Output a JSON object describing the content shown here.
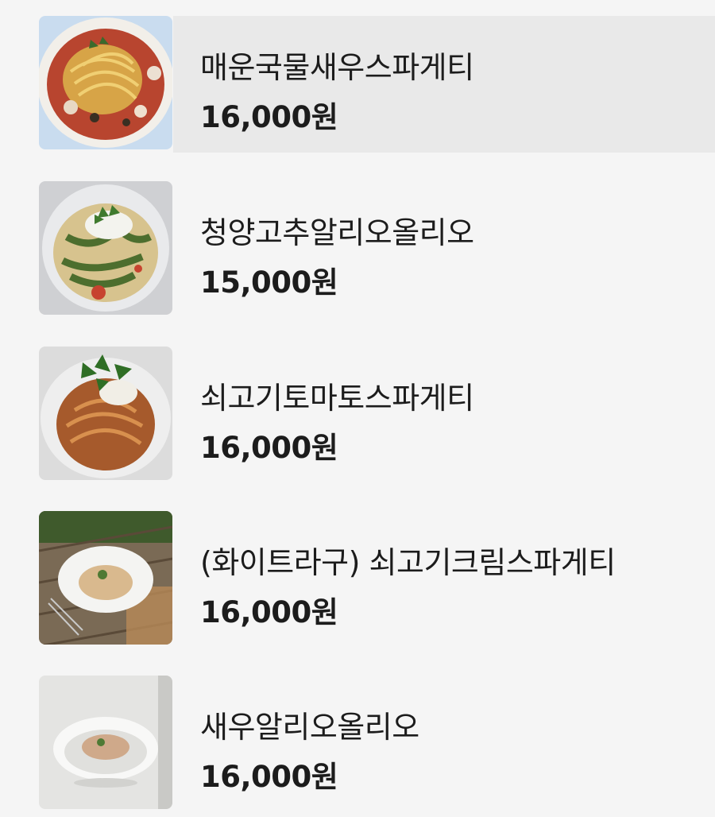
{
  "menu": {
    "items": [
      {
        "name": "매운국물새우스파게티",
        "price": "16,000원",
        "image_icon": "spicy-shrimp-spaghetti-photo"
      },
      {
        "name": "청양고추알리오올리오",
        "price": "15,000원",
        "image_icon": "chili-aglio-olio-photo"
      },
      {
        "name": "쇠고기토마토스파게티",
        "price": "16,000원",
        "image_icon": "beef-tomato-spaghetti-photo"
      },
      {
        "name": "(화이트라구) 쇠고기크림스파게티",
        "price": "16,000원",
        "image_icon": "beef-cream-spaghetti-photo"
      },
      {
        "name": "새우알리오올리오",
        "price": "16,000원",
        "image_icon": "shrimp-aglio-olio-photo"
      }
    ]
  }
}
